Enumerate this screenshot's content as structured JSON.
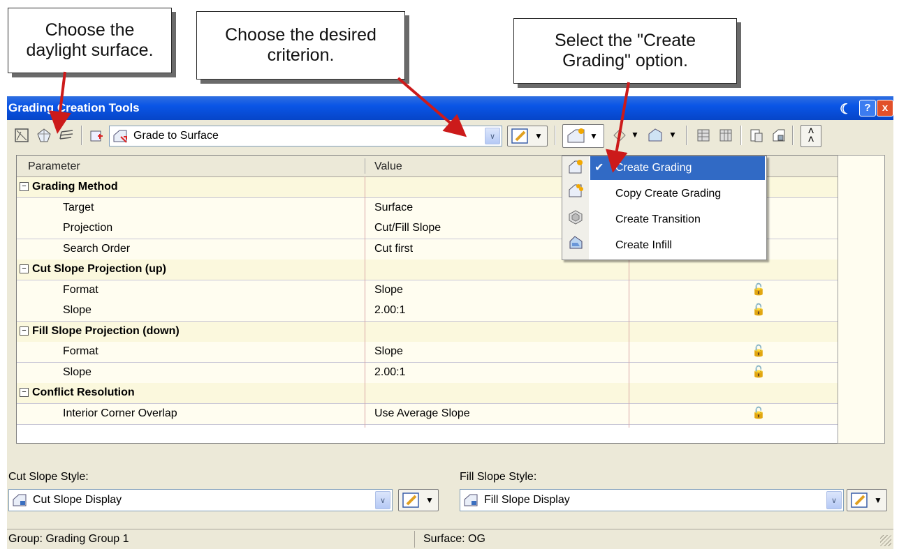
{
  "callouts": {
    "daylight": "Choose the daylight surface.",
    "criterion": "Choose the desired criterion.",
    "create_grading": "Select the \"Create Grading\" option."
  },
  "window": {
    "title": "Grading Creation Tools",
    "help_label": "?",
    "close_label": "x"
  },
  "toolbar": {
    "criteria_combo_value": "Grade to Surface"
  },
  "grid": {
    "headers": {
      "parameter": "Parameter",
      "value": "Value"
    },
    "rows": [
      {
        "label": "Grading Method",
        "category": true,
        "value": "",
        "lock": false
      },
      {
        "label": "Target",
        "category": false,
        "value": "Surface",
        "lock": false
      },
      {
        "label": "Projection",
        "category": false,
        "value": "Cut/Fill Slope",
        "lock": false
      },
      {
        "label": "Search Order",
        "category": false,
        "value": "Cut first",
        "lock": true
      },
      {
        "label": "Cut Slope Projection (up)",
        "category": true,
        "value": "",
        "lock": false
      },
      {
        "label": "Format",
        "category": false,
        "value": "Slope",
        "lock": true
      },
      {
        "label": "Slope",
        "category": false,
        "value": "2.00:1",
        "lock": true
      },
      {
        "label": "Fill Slope Projection (down)",
        "category": true,
        "value": "",
        "lock": false
      },
      {
        "label": "Format",
        "category": false,
        "value": "Slope",
        "lock": true
      },
      {
        "label": "Slope",
        "category": false,
        "value": "2.00:1",
        "lock": true
      },
      {
        "label": "Conflict Resolution",
        "category": true,
        "value": "",
        "lock": false
      },
      {
        "label": "Interior Corner Overlap",
        "category": false,
        "value": "Use Average Slope",
        "lock": true
      }
    ]
  },
  "menu": {
    "items": [
      {
        "label": "Create Grading",
        "checked": true,
        "icon": "create-grading-icon"
      },
      {
        "label": "Copy Create Grading",
        "checked": false,
        "icon": "copy-create-grading-icon"
      },
      {
        "label": "Create Transition",
        "checked": false,
        "icon": "create-transition-icon"
      },
      {
        "label": "Create Infill",
        "checked": false,
        "icon": "create-infill-icon"
      }
    ]
  },
  "bottom": {
    "cut_slope_label": "Cut Slope Style:",
    "cut_slope_value": "Cut Slope Display",
    "fill_slope_label": "Fill Slope Style:",
    "fill_slope_value": "Fill Slope Display"
  },
  "status": {
    "group": "Group: Grading Group 1",
    "surface": "Surface: OG"
  },
  "colors": {
    "title_bar": "#0a55e6",
    "selection": "#316ac5",
    "arrow": "#cc1a1a",
    "row_bg": "#fffdf0"
  }
}
